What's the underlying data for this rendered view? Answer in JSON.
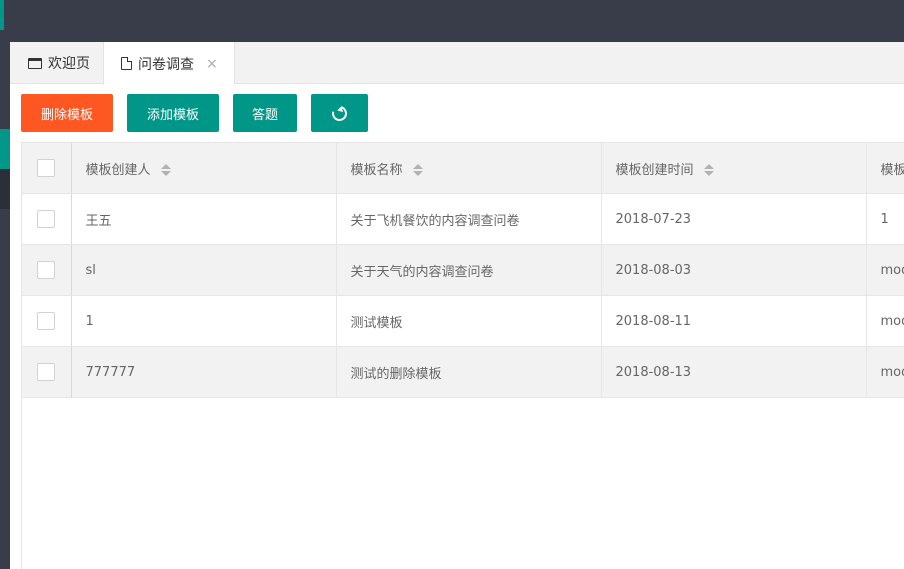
{
  "tabs": {
    "home_label": "欢迎页",
    "survey_label": "问卷调查",
    "close_glyph": "×"
  },
  "toolbar": {
    "delete_label": "删除模板",
    "add_label": "添加模板",
    "answer_label": "答题"
  },
  "table": {
    "headers": [
      "模板创建人",
      "模板名称",
      "模板创建时间",
      "模板"
    ],
    "rows": [
      {
        "creator": "王五",
        "name": "关于飞机餐饮的内容调查问卷",
        "created": "2018-07-23",
        "extra": "1"
      },
      {
        "creator": "sl",
        "name": "关于天气的内容调查问卷",
        "created": "2018-08-03",
        "extra": "mod"
      },
      {
        "creator": "1",
        "name": "测试模板",
        "created": "2018-08-11",
        "extra": "mod"
      },
      {
        "creator": "777777",
        "name": "测试的删除模板",
        "created": "2018-08-13",
        "extra": "mod"
      }
    ]
  },
  "colors": {
    "topbar": "#393d49",
    "primary": "#009688",
    "danger": "#ff5722"
  }
}
